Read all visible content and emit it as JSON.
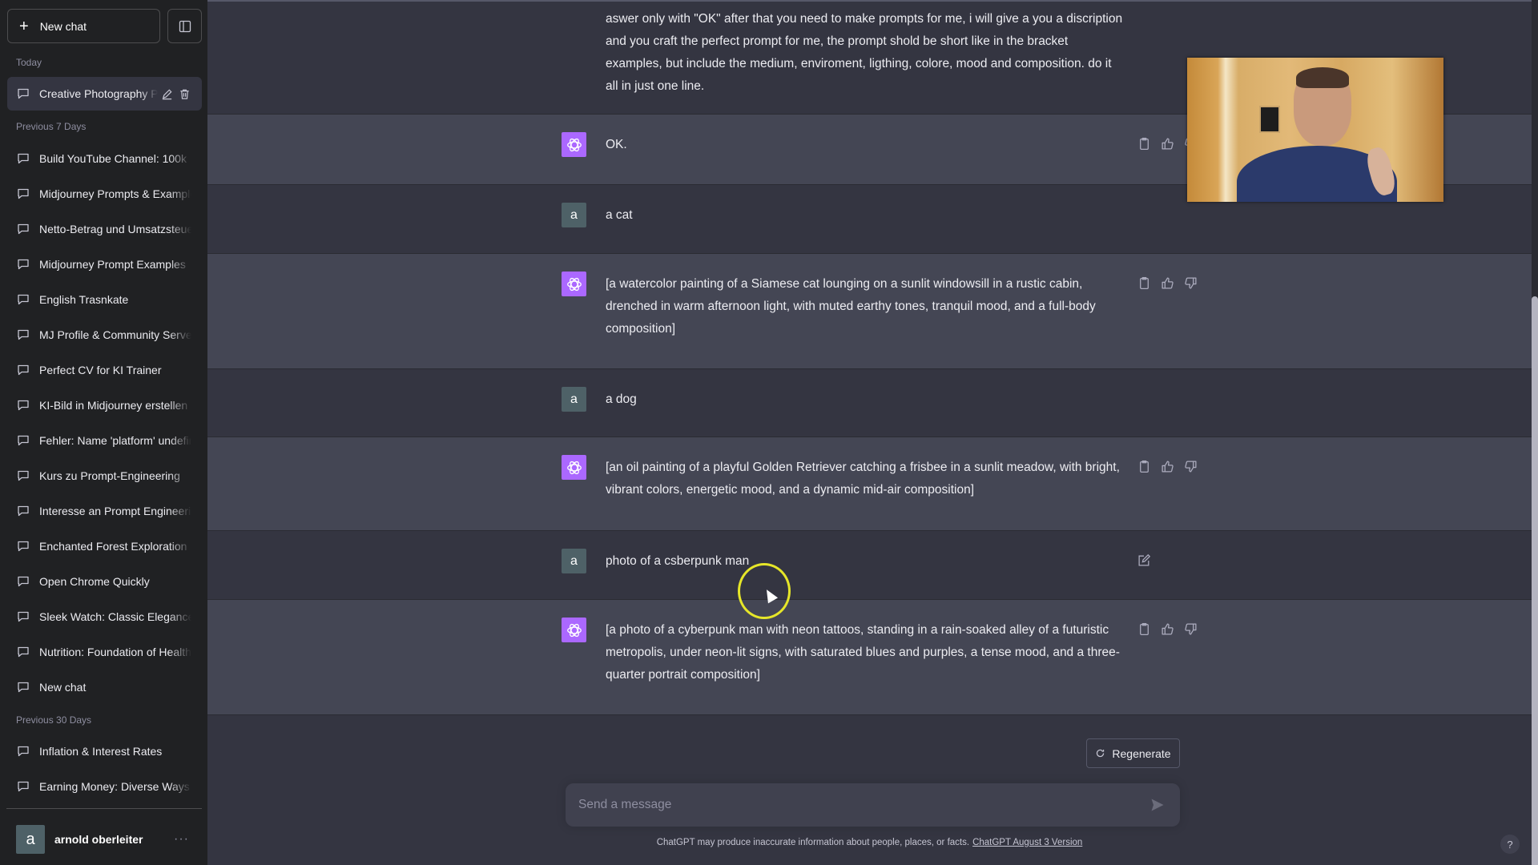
{
  "sidebar": {
    "new_chat_label": "New chat",
    "sections": {
      "today": "Today",
      "prev7": "Previous 7 Days",
      "prev30": "Previous 30 Days"
    },
    "active_item": "Creative Photography P",
    "items_prev7": [
      "Build YouTube Channel: 100k",
      "Midjourney Prompts & Examples",
      "Netto-Betrag und Umsatzsteuer",
      "Midjourney Prompt Examples",
      "English Trasnkate",
      "MJ Profile & Community Server",
      "Perfect CV for KI Trainer",
      "KI-Bild in Midjourney erstellen",
      "Fehler: Name 'platform' undefined",
      "Kurs zu Prompt-Engineering",
      "Interesse an Prompt Engineering",
      "Enchanted Forest Exploration",
      "Open Chrome Quickly",
      "Sleek Watch: Classic Elegance",
      "Nutrition: Foundation of Health",
      "New chat"
    ],
    "items_prev30": [
      "Inflation & Interest Rates",
      "Earning Money: Diverse Ways"
    ],
    "user": {
      "initial": "a",
      "name": "arnold oberleiter",
      "more": "···"
    }
  },
  "conversation": {
    "messages": [
      {
        "role": "user",
        "text": "aswer only with \"OK\" after that you need to make prompts for me, i will give a you a discription and you craft the perfect prompt for me, the prompt shold be short like in the bracket examples, but include the medium, enviroment, ligthing, colore, mood and composition. do it all in just one line."
      },
      {
        "role": "assistant",
        "text": "OK."
      },
      {
        "role": "user",
        "text": "a cat"
      },
      {
        "role": "assistant",
        "text": "[a watercolor painting of a Siamese cat lounging on a sunlit windowsill in a rustic cabin, drenched in warm afternoon light, with muted earthy tones, tranquil mood, and a full-body composition]"
      },
      {
        "role": "user",
        "text": "a dog"
      },
      {
        "role": "assistant",
        "text": "[an oil painting of a playful Golden Retriever catching a frisbee in a sunlit meadow, with bright, vibrant colors, energetic mood, and a dynamic mid-air composition]"
      },
      {
        "role": "user",
        "text": "photo of a csberpunk man"
      },
      {
        "role": "assistant",
        "text": "[a photo of a cyberpunk man with neon tattoos, standing in a rain-soaked alley of a futuristic metropolis, under neon-lit signs, with saturated blues and purples, a tense mood, and a three-quarter portrait composition]"
      }
    ],
    "user_initial": "a"
  },
  "composer": {
    "regenerate_label": "Regenerate",
    "placeholder": "Send a message",
    "value": ""
  },
  "footer": {
    "disclaimer": "ChatGPT may produce inaccurate information about people, places, or facts.",
    "version_link": "ChatGPT August 3 Version",
    "help": "?"
  },
  "colors": {
    "sidebar_bg": "#202123",
    "main_bg": "#343541",
    "assistant_row_bg": "#444654",
    "gpt_avatar": "#ab68ff",
    "user_avatar": "#4e6167",
    "cursor_highlight": "#e6e629"
  }
}
